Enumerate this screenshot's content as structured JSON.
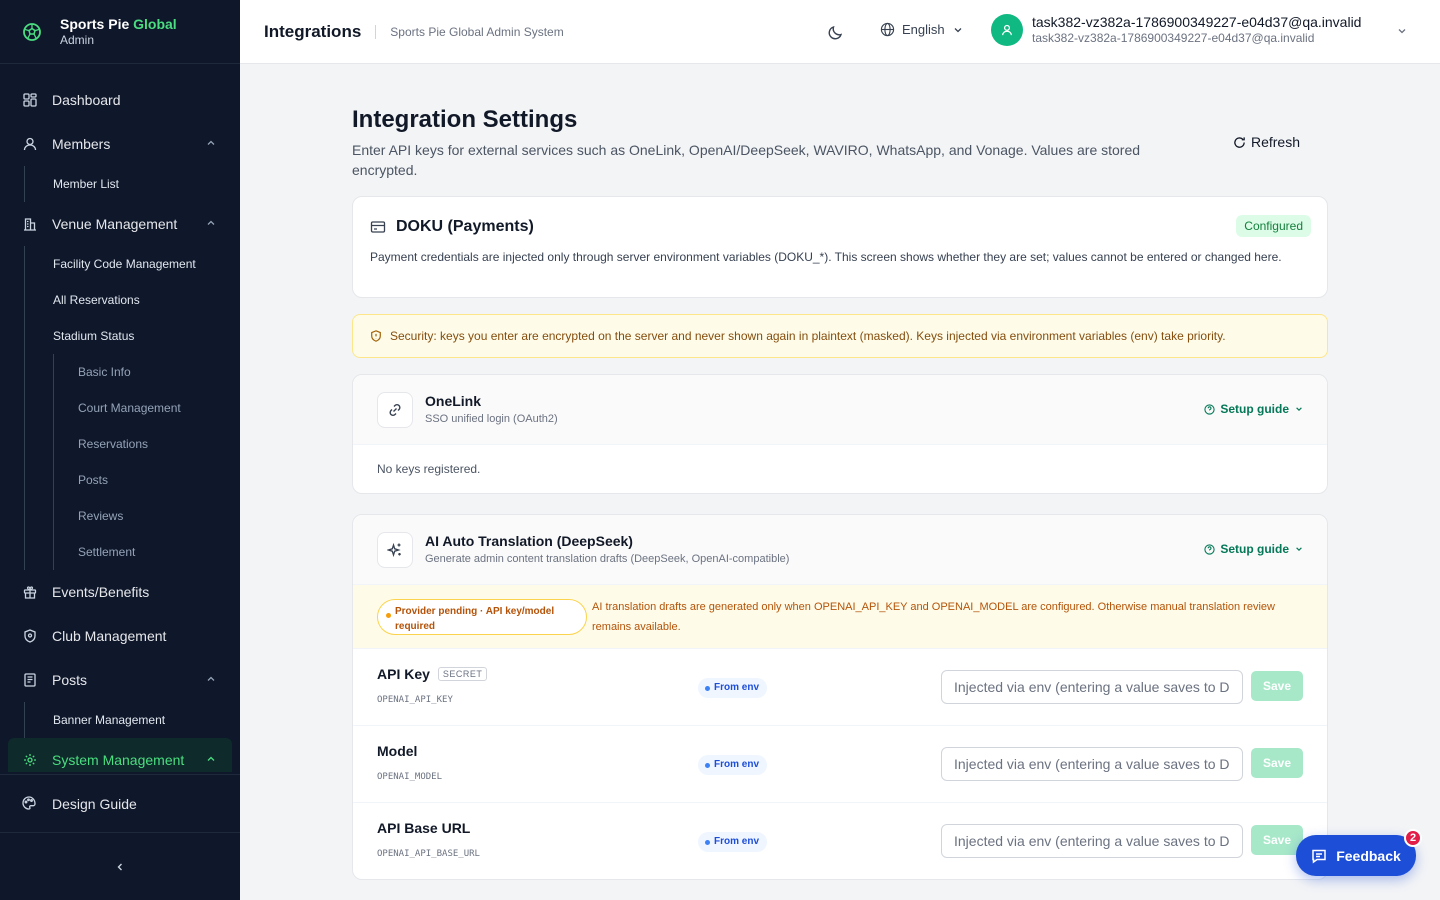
{
  "brand": {
    "title_main": "Sports Pie",
    "title_accent": "Global",
    "subtitle": "Admin"
  },
  "sidebar": {
    "dashboard": "Dashboard",
    "members": "Members",
    "member_list": "Member List",
    "venue": "Venue Management",
    "facility_code": "Facility Code Management",
    "all_reservations": "All Reservations",
    "stadium_status": "Stadium Status",
    "stadium_sub": [
      "Basic Info",
      "Court Management",
      "Reservations",
      "Posts",
      "Reviews",
      "Settlement"
    ],
    "events": "Events/Benefits",
    "club": "Club Management",
    "posts": "Posts",
    "banner": "Banner Management",
    "system": "System Management",
    "design_guide": "Design Guide"
  },
  "header": {
    "title": "Integrations",
    "subtitle": "Sports Pie Global Admin System",
    "language": "English",
    "user_name": "task382-vz382a-1786900349227-e04d37@qa.invalid",
    "user_email": "task382-vz382a-1786900349227-e04d37@qa.invalid"
  },
  "page": {
    "title": "Integration Settings",
    "description": "Enter API keys for external services such as OneLink, OpenAI/DeepSeek, WAVIRO, WhatsApp, and Vonage. Values are stored encrypted.",
    "refresh": "Refresh"
  },
  "doku": {
    "title": "DOKU (Payments)",
    "status": "Configured",
    "description": "Payment credentials are injected only through server environment variables (DOKU_*). This screen shows whether they are set; values cannot be entered or changed here."
  },
  "security_notice": "Security: keys you enter are encrypted on the server and never shown again in plaintext (masked). Keys injected via environment variables (env) take priority.",
  "onelink": {
    "name": "OneLink",
    "subtitle": "SSO unified login (OAuth2)",
    "guide": "Setup guide",
    "empty": "No keys registered."
  },
  "ai": {
    "name": "AI Auto Translation (DeepSeek)",
    "subtitle": "Generate admin content translation drafts (DeepSeek, OpenAI-compatible)",
    "guide": "Setup guide",
    "pending_badge": "Provider pending · API key/model required",
    "pending_text": "AI translation drafts are generated only when OPENAI_API_KEY and OPENAI_MODEL are configured. Otherwise manual translation review remains available.",
    "rows": [
      {
        "label": "API Key",
        "secret": "SECRET",
        "env": "OPENAI_API_KEY",
        "source": "From env",
        "placeholder": "Injected via env (entering a value saves to DB)",
        "save": "Save"
      },
      {
        "label": "Model",
        "env": "OPENAI_MODEL",
        "source": "From env",
        "placeholder": "Injected via env (entering a value saves to DB)",
        "save": "Save"
      },
      {
        "label": "API Base URL",
        "env": "OPENAI_API_BASE_URL",
        "source": "From env",
        "placeholder": "Injected via env (entering a value saves to DB)",
        "save": "Save"
      }
    ]
  },
  "feedback": {
    "label": "Feedback",
    "count": "2"
  },
  "colors": {
    "sidebar_bg": "#0f172a",
    "accent_green": "#4ade80",
    "primary_blue": "#1d4ed8",
    "badge_red": "#e11d48"
  }
}
